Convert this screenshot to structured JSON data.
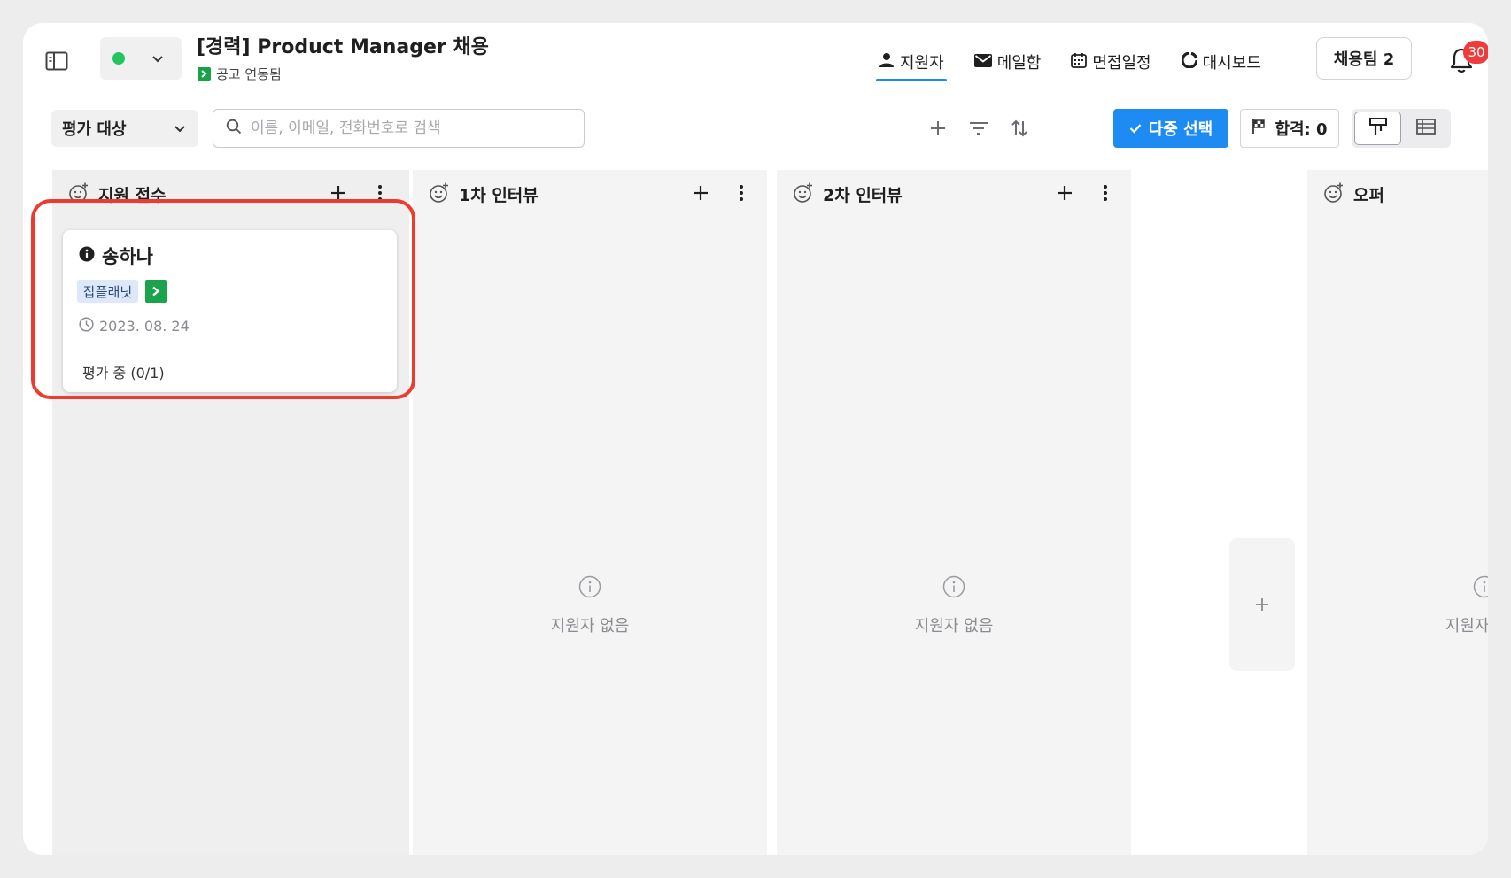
{
  "header": {
    "job_title": "[경력] Product Manager 채용",
    "job_subtitle": "공고 연동됨",
    "status_color": "#22c55e",
    "nav_tabs": [
      {
        "label": "지원자",
        "icon": "person-icon",
        "active": true
      },
      {
        "label": "메일함",
        "icon": "mail-icon",
        "active": false
      },
      {
        "label": "면접일정",
        "icon": "calendar-icon",
        "active": false
      },
      {
        "label": "대시보드",
        "icon": "dashboard-icon",
        "active": false
      }
    ],
    "team_button": "채용팀 2",
    "notification_count": "30"
  },
  "toolbar": {
    "filter_value": "평가 대상",
    "search_placeholder": "이름, 이메일, 전화번호로 검색",
    "multi_select_label": "다중 선택",
    "pass_count_label": "합격: 0",
    "view_mode": "kanban"
  },
  "columns": [
    {
      "title": "지원 접수",
      "cards": [
        {
          "name": "송하나",
          "source_tag": "잡플래닛",
          "date": "2023. 08. 24",
          "evaluation": "평가 중 (0/1)"
        }
      ]
    },
    {
      "title": "1차 인터뷰",
      "empty_text": "지원자 없음"
    },
    {
      "title": "2차 인터뷰",
      "empty_text": "지원자 없음"
    },
    {
      "title": "오퍼",
      "empty_text": "지원자 없음"
    }
  ],
  "colors": {
    "accent": "#1d8bf1",
    "highlight": "#ef3b2d",
    "badge": "#ef3b3b",
    "source_logo": "#19a34a"
  }
}
